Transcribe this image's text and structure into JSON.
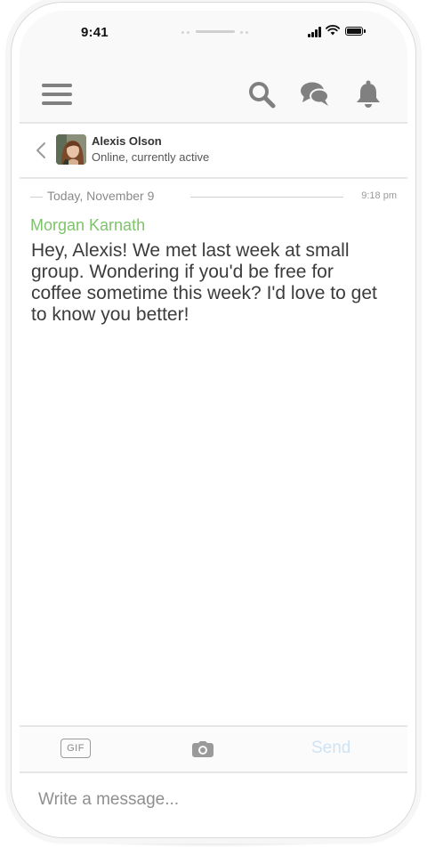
{
  "status_bar": {
    "time": "9:41"
  },
  "header": {
    "menu_icon": "hamburger-menu-icon",
    "search_icon": "search-icon",
    "messages_icon": "chat-bubbles-icon",
    "notifications_icon": "bell-icon"
  },
  "chat": {
    "back_icon": "chevron-left-icon",
    "contact_name": "Alexis Olson",
    "contact_status": "Online, currently active"
  },
  "conversation": {
    "date_label": "Today, November 9",
    "time_label": "9:18 pm",
    "messages": [
      {
        "sender": "Morgan Karnath",
        "text": "Hey, Alexis! We met last week at small group. Wondering if you'd be free for coffee sometime this week? I'd love to get to know you better!"
      }
    ]
  },
  "composer": {
    "gif_label": "GIF",
    "camera_icon": "camera-icon",
    "send_label": "Send",
    "placeholder": "Write a message...",
    "value": ""
  },
  "colors": {
    "sender_name": "#7dc46a",
    "send_disabled": "#cfe3f4",
    "icon_gray": "#808080",
    "divider": "#e6e6e6"
  }
}
